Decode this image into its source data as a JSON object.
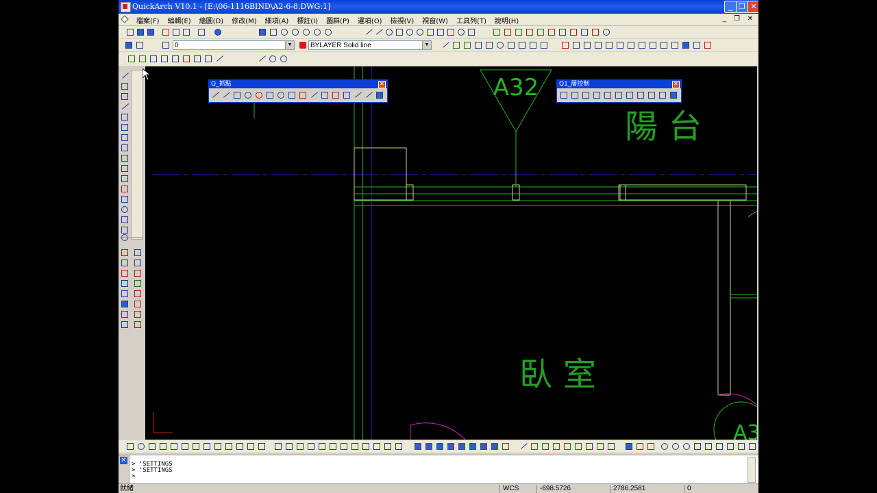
{
  "window": {
    "title": "QuickArch V10.1 - [E:\\06-1116BIND\\A2-6-8.DWG:1]",
    "minimize_glyph": "_",
    "restore_glyph": "❐",
    "close_glyph": "✕"
  },
  "menu": {
    "items": [
      {
        "label": "檔案(F)"
      },
      {
        "label": "編輯(E)"
      },
      {
        "label": "繪圖(D)"
      },
      {
        "label": "修改(M)"
      },
      {
        "label": "細項(A)"
      },
      {
        "label": "標註(I)"
      },
      {
        "label": "圖群(P)"
      },
      {
        "label": "選項(O)"
      },
      {
        "label": "檢視(V)"
      },
      {
        "label": "視窗(W)"
      },
      {
        "label": "工具列(T)"
      },
      {
        "label": "說明(H)"
      }
    ],
    "mdi_controls": "_ ❐ ✕"
  },
  "properties_bar": {
    "layer_value": "0",
    "linetype_value": "BYLAYER Solid line",
    "color_swatch": "#e01616"
  },
  "floating_palettes": [
    {
      "title": "Q_抓點"
    },
    {
      "title": "Q1_層控制"
    }
  ],
  "drawing": {
    "tag_label": "A32",
    "room_balcony": "陽台",
    "room_bedroom": "臥室",
    "corner_tag": "A3"
  },
  "command": {
    "lines": [
      "> 'SETTINGS",
      "> 'SETTINGS",
      ">"
    ]
  },
  "status": {
    "ready": "就緒",
    "coord_system": "WCS",
    "x": "-698.5726",
    "y": "2786.2581",
    "z": "0"
  },
  "colors": {
    "title_bar": "#0a3fd8",
    "cad_background": "#000000",
    "wall_green": "#1fb81f",
    "door_magenta": "#d21ad2",
    "grid_blue": "#2424c8",
    "window_yellow": "#d4d080",
    "text_green": "#22a022"
  }
}
